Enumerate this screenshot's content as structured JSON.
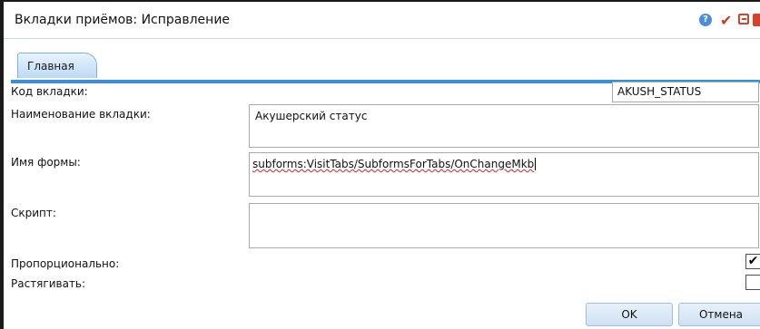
{
  "window": {
    "title": "Вкладки приёмов: Исправление",
    "help_symbol": "?",
    "check_symbol": "✔"
  },
  "tabs": [
    {
      "label": "Главная",
      "active": true
    }
  ],
  "form": {
    "tab_code": {
      "label": "Код вкладки:",
      "value": "AKUSH_STATUS"
    },
    "tab_name": {
      "label": "Наименование вкладки:",
      "value": "Акушерский статус"
    },
    "form_name": {
      "label": "Имя формы:",
      "value": "subforms:VisitTabs/SubformsForTabs/OnChangeMkb"
    },
    "script": {
      "label": "Скрипт:",
      "value": ""
    },
    "proportional": {
      "label": "Пропорционально:",
      "checked": true,
      "mark": "✔"
    },
    "stretch": {
      "label": "Растягивать:",
      "checked": false
    }
  },
  "buttons": {
    "ok": "OK",
    "cancel": "Отмена"
  },
  "colors": {
    "accent": "#3b8fd9",
    "close": "#d8412a"
  }
}
